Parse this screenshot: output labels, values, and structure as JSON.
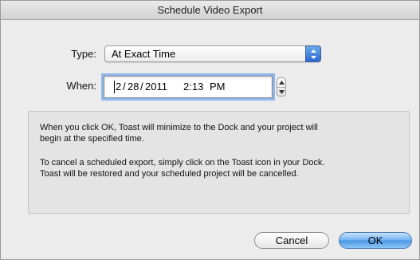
{
  "dialog": {
    "title": "Schedule Video Export"
  },
  "type_field": {
    "label": "Type:",
    "value": "At Exact Time"
  },
  "when_field": {
    "label": "When:",
    "month": "2",
    "day": "28",
    "year": "2011",
    "time": "2:13",
    "ampm": "PM"
  },
  "info": {
    "line1": "When you click OK, Toast will minimize to the Dock and your project will",
    "line2": "begin at the specified time.",
    "line3": "To cancel a scheduled export, simply click on the Toast icon in your Dock.",
    "line4": "Toast will be restored and your scheduled project will be cancelled."
  },
  "buttons": {
    "cancel": "Cancel",
    "ok": "OK"
  },
  "colors": {
    "accent": "#4a95e4",
    "focus_ring": "#8fb6ea",
    "background": "#ececec"
  }
}
